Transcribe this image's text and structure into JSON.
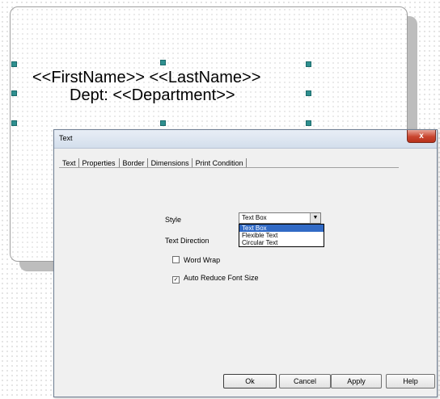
{
  "label": {
    "line1": "<<FirstName>> <<LastName>>",
    "line2": "Dept: <<Department>>"
  },
  "dialog": {
    "title": "Text",
    "close_label": "x",
    "tabs": [
      {
        "label": "Text",
        "active": false
      },
      {
        "label": "Properties",
        "active": true
      },
      {
        "label": "Border",
        "active": false
      },
      {
        "label": "Dimensions",
        "active": false
      },
      {
        "label": "Print Condition",
        "active": false
      }
    ],
    "properties": {
      "style_label": "Style",
      "style_value": "Text Box",
      "style_options": [
        "Text Box",
        "Flexible Text",
        "Circular Text"
      ],
      "style_selected_index": 0,
      "text_direction_label": "Text Direction",
      "word_wrap": {
        "label": "Word Wrap",
        "checked": false
      },
      "auto_reduce": {
        "label": "Auto Reduce Font Size",
        "checked": true
      }
    },
    "buttons": {
      "ok": "Ok",
      "cancel": "Cancel",
      "apply": "Apply",
      "help": "Help"
    }
  },
  "colors": {
    "handle": "#2f8f8f",
    "selection": "#316ac5",
    "close_button": "#c9452f"
  }
}
